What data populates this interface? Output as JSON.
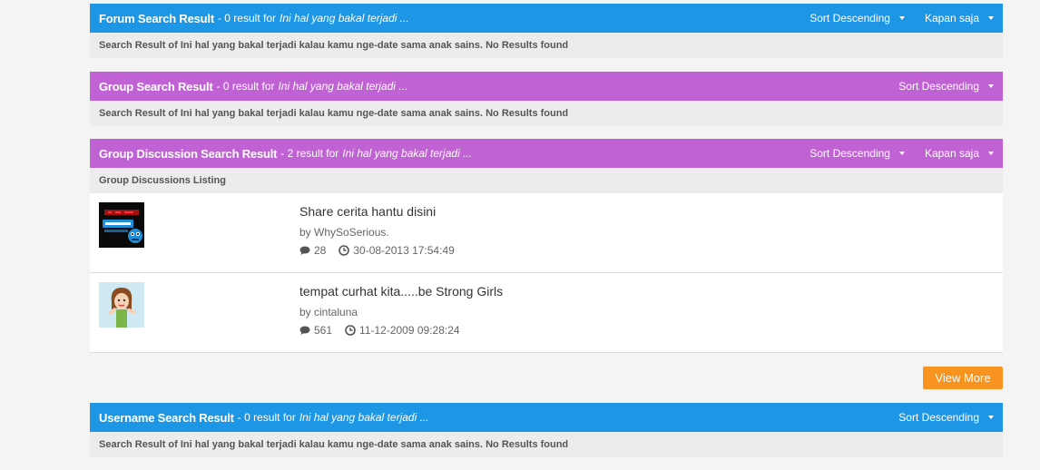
{
  "forum": {
    "title": "Forum Search Result",
    "meta": "- 0 result for",
    "query": "Ini hal yang bakal terjadi ...",
    "sort_label": "Sort Descending",
    "time_label": "Kapan saja",
    "message": "Search Result of Ini hal yang bakal terjadi kalau kamu nge-date sama anak sains. No Results found"
  },
  "group": {
    "title": "Group Search Result",
    "meta": "- 0 result for",
    "query": "Ini hal yang bakal terjadi ...",
    "sort_label": "Sort Descending",
    "message": "Search Result of Ini hal yang bakal terjadi kalau kamu nge-date sama anak sains. No Results found"
  },
  "discussion": {
    "title": "Group Discussion Search Result",
    "meta": "- 2 result for",
    "query": "Ini hal yang bakal terjadi ...",
    "sort_label": "Sort Descending",
    "time_label": "Kapan saja",
    "listing_label": "Group Discussions Listing",
    "items": [
      {
        "title": "Share cerita hantu disini",
        "by": "by WhySoSerious.",
        "comments": "28",
        "date": "30-08-2013 17:54:49"
      },
      {
        "title": "tempat curhat kita.....be Strong Girls",
        "by": "by cintaluna",
        "comments": "561",
        "date": "11-12-2009 09:28:24"
      }
    ],
    "view_more_label": "View More"
  },
  "username": {
    "title": "Username Search Result",
    "meta": "- 0 result for",
    "query": "Ini hal yang bakal terjadi ...",
    "sort_label": "Sort Descending",
    "message": "Search Result of Ini hal yang bakal terjadi kalau kamu nge-date sama anak sains. No Results found"
  },
  "colors": {
    "blue_header": "#1e96e6",
    "purple_header": "#c062d4",
    "view_more": "#f7931e"
  }
}
